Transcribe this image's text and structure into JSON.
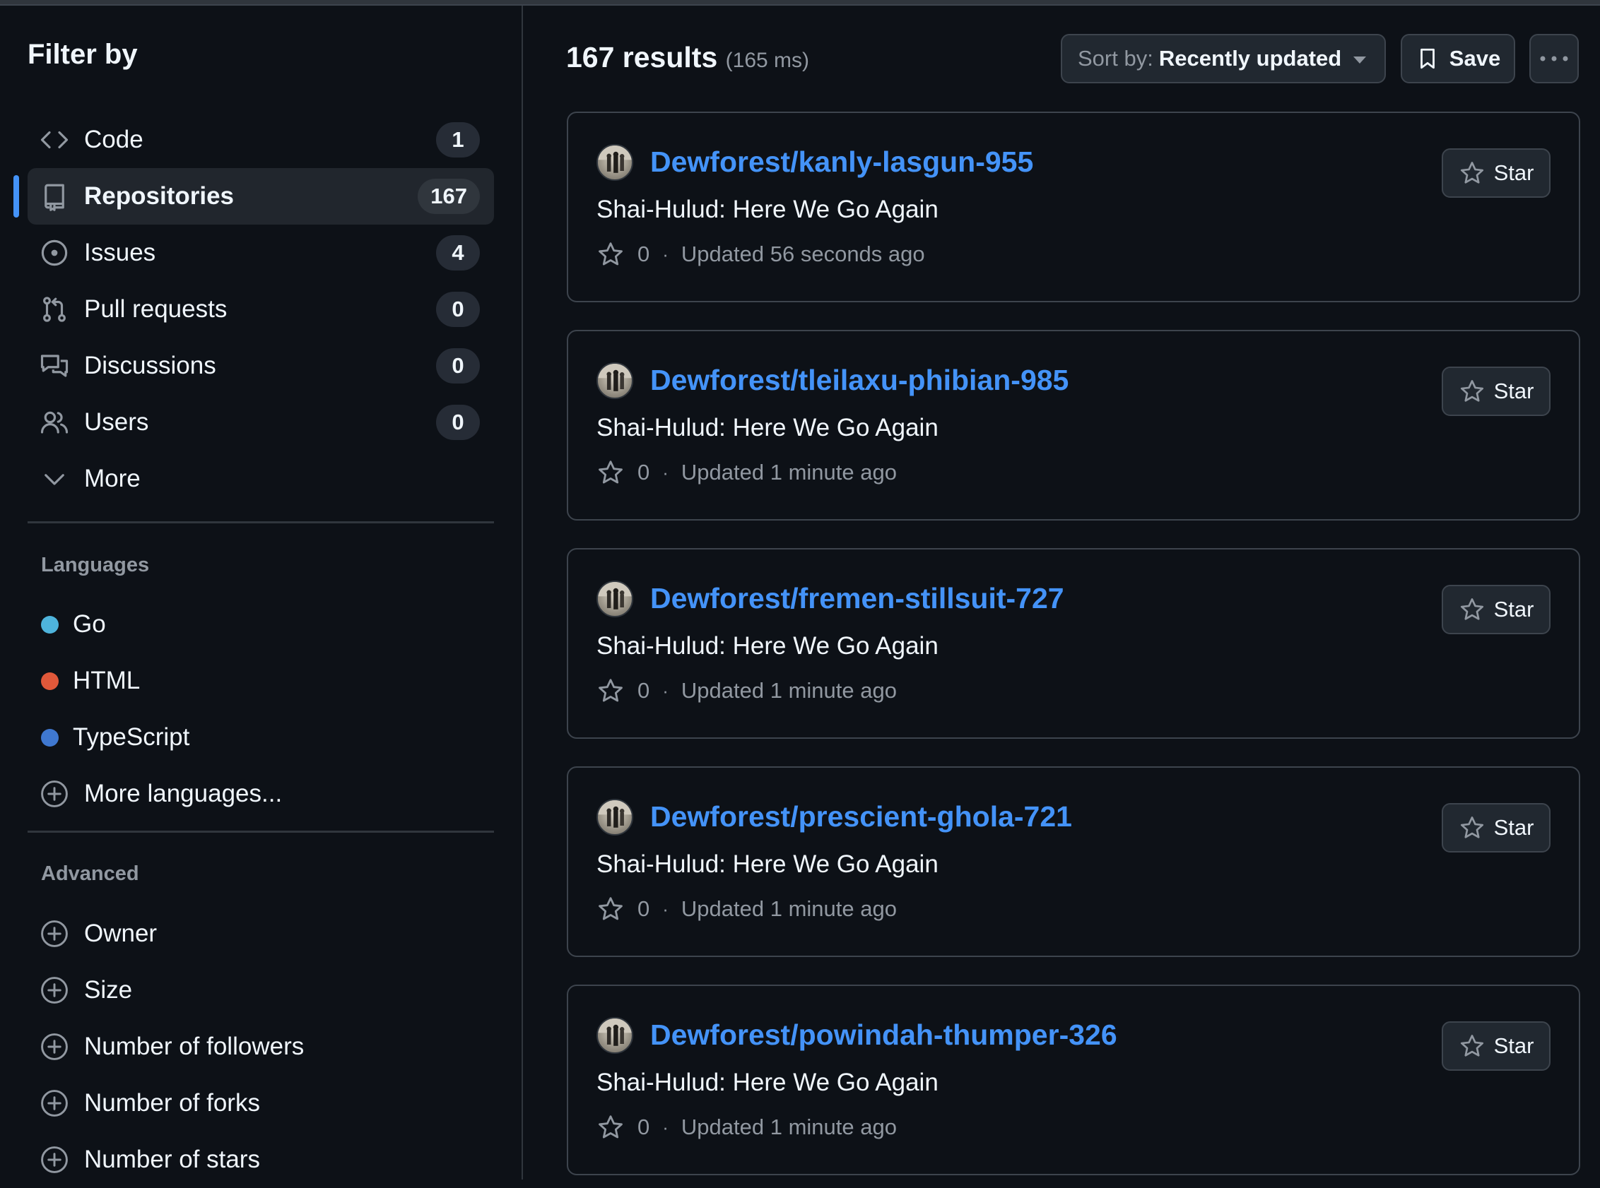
{
  "sidebar": {
    "title": "Filter by",
    "nav": [
      {
        "label": "Code",
        "count": "1",
        "icon": "code-icon"
      },
      {
        "label": "Repositories",
        "count": "167",
        "icon": "repo-icon",
        "active": true
      },
      {
        "label": "Issues",
        "count": "4",
        "icon": "issue-icon"
      },
      {
        "label": "Pull requests",
        "count": "0",
        "icon": "pull-request-icon"
      },
      {
        "label": "Discussions",
        "count": "0",
        "icon": "discussion-icon"
      },
      {
        "label": "Users",
        "count": "0",
        "icon": "people-icon"
      },
      {
        "label": "More",
        "icon": "chevron-down-icon"
      }
    ],
    "languages_title": "Languages",
    "languages": [
      {
        "label": "Go",
        "color": "#00add8"
      },
      {
        "label": "HTML",
        "color": "#e34c26"
      },
      {
        "label": "TypeScript",
        "color": "#3178c6"
      }
    ],
    "more_languages": "More languages...",
    "advanced_title": "Advanced",
    "advanced": [
      "Owner",
      "Size",
      "Number of followers",
      "Number of forks",
      "Number of stars"
    ]
  },
  "main": {
    "results_count": "167 results",
    "results_time": "(165 ms)",
    "sort_prefix": "Sort by:",
    "sort_value": "Recently updated",
    "save_label": "Save",
    "star_label": "Star",
    "results": [
      {
        "name": "Dewforest/kanly-lasgun-955",
        "description": "Shai-Hulud: Here We Go Again",
        "stars": "0",
        "updated": "Updated 56 seconds ago"
      },
      {
        "name": "Dewforest/tleilaxu-phibian-985",
        "description": "Shai-Hulud: Here We Go Again",
        "stars": "0",
        "updated": "Updated 1 minute ago"
      },
      {
        "name": "Dewforest/fremen-stillsuit-727",
        "description": "Shai-Hulud: Here We Go Again",
        "stars": "0",
        "updated": "Updated 1 minute ago"
      },
      {
        "name": "Dewforest/prescient-ghola-721",
        "description": "Shai-Hulud: Here We Go Again",
        "stars": "0",
        "updated": "Updated 1 minute ago"
      },
      {
        "name": "Dewforest/powindah-thumper-326",
        "description": "Shai-Hulud: Here We Go Again",
        "stars": "0",
        "updated": "Updated 1 minute ago"
      }
    ]
  },
  "colors": {
    "background": "#0d1117",
    "link": "#4493f8",
    "active_indicator": "#4493f8",
    "muted_text": "#9198a1",
    "border": "#3d444d"
  }
}
